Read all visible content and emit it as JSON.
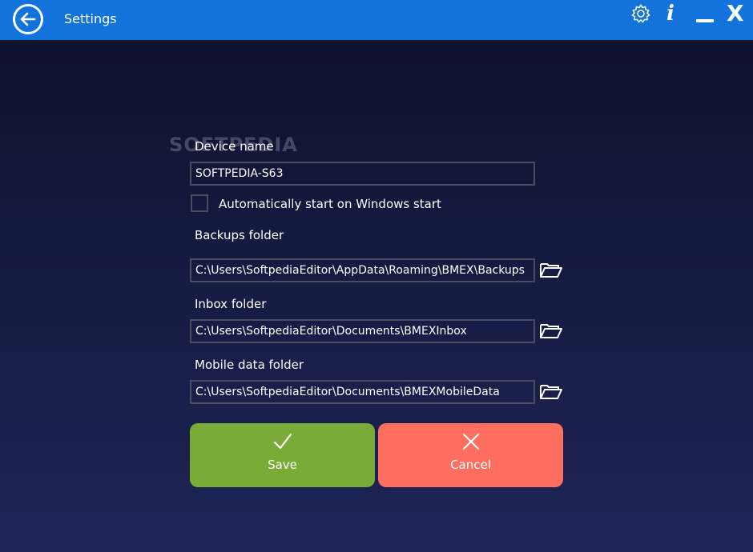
{
  "header": {
    "title": "Settings",
    "icons": {
      "back": "back-arrow-icon",
      "settings": "gear-icon",
      "info_glyph": "i",
      "minimize": "minimize-icon",
      "close_glyph": "X"
    }
  },
  "watermark": "SOFTPEDIA",
  "form": {
    "device_name_label": "Device name",
    "device_name_value": "SOFTPEDIA-S63",
    "auto_start_label": "Automatically start on Windows start",
    "auto_start_checked": false,
    "backups_label": "Backups folder",
    "backups_value": "C:\\Users\\SoftpediaEditor\\AppData\\Roaming\\BMEX\\Backups",
    "inbox_label": "Inbox folder",
    "inbox_value": "C:\\Users\\SoftpediaEditor\\Documents\\BMEXInbox",
    "mobile_label": "Mobile data folder",
    "mobile_value": "C:\\Users\\SoftpediaEditor\\Documents\\BMEXMobileData"
  },
  "buttons": {
    "save_label": "Save",
    "cancel_label": "Cancel"
  },
  "colors": {
    "titlebar": "#1373dd",
    "save": "#7aab37",
    "cancel": "#ff6e5e"
  }
}
